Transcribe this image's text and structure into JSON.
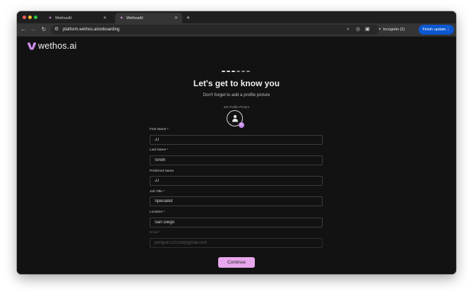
{
  "browser": {
    "tabs": [
      {
        "title": "WethosAI",
        "active": false
      },
      {
        "title": "WethosAI",
        "active": true
      }
    ],
    "new_tab_glyph": "+",
    "url": "platform.wethos.ai/onboarding",
    "incognito_label": "Incognito (2)",
    "finish_update_label": "Finish update"
  },
  "icons": {
    "favicon": "wethos-logo-icon",
    "tab_close": "close-icon",
    "back": "arrow-left-icon",
    "forward": "arrow-right-icon",
    "reload": "reload-icon",
    "site_settings": "tune-icon",
    "zoom": "zoom-icon",
    "tracking": "eye-off-icon",
    "bookmark": "star-icon",
    "side_panel": "side-panel-icon",
    "incognito": "incognito-icon",
    "menu": "kebab-menu-icon",
    "avatar": "person-icon",
    "edit": "pencil-icon"
  },
  "brand": {
    "logo_text": "wethos.ai",
    "accent": "#e8a6ec",
    "logo_color": "#c98de8"
  },
  "onboarding": {
    "steps_total": 6,
    "steps_done": 3,
    "title": "Let's get to know you",
    "subtitle": "Don't forget to add a profile picture",
    "profile_picture_label": "Set Profile Picture",
    "fields": [
      {
        "label": "First Name *",
        "value": "JJ",
        "disabled": false
      },
      {
        "label": "Last Name *",
        "value": "Smith",
        "disabled": false
      },
      {
        "label": "Preferred Name",
        "value": "JJ",
        "disabled": false
      },
      {
        "label": "Job Title *",
        "value": "Specialist",
        "disabled": false
      },
      {
        "label": "Location *",
        "value": "San Diego",
        "disabled": false
      },
      {
        "label": "Email *",
        "value": "penguin120118@gmail.com",
        "disabled": true
      }
    ],
    "continue_label": "Continue"
  }
}
